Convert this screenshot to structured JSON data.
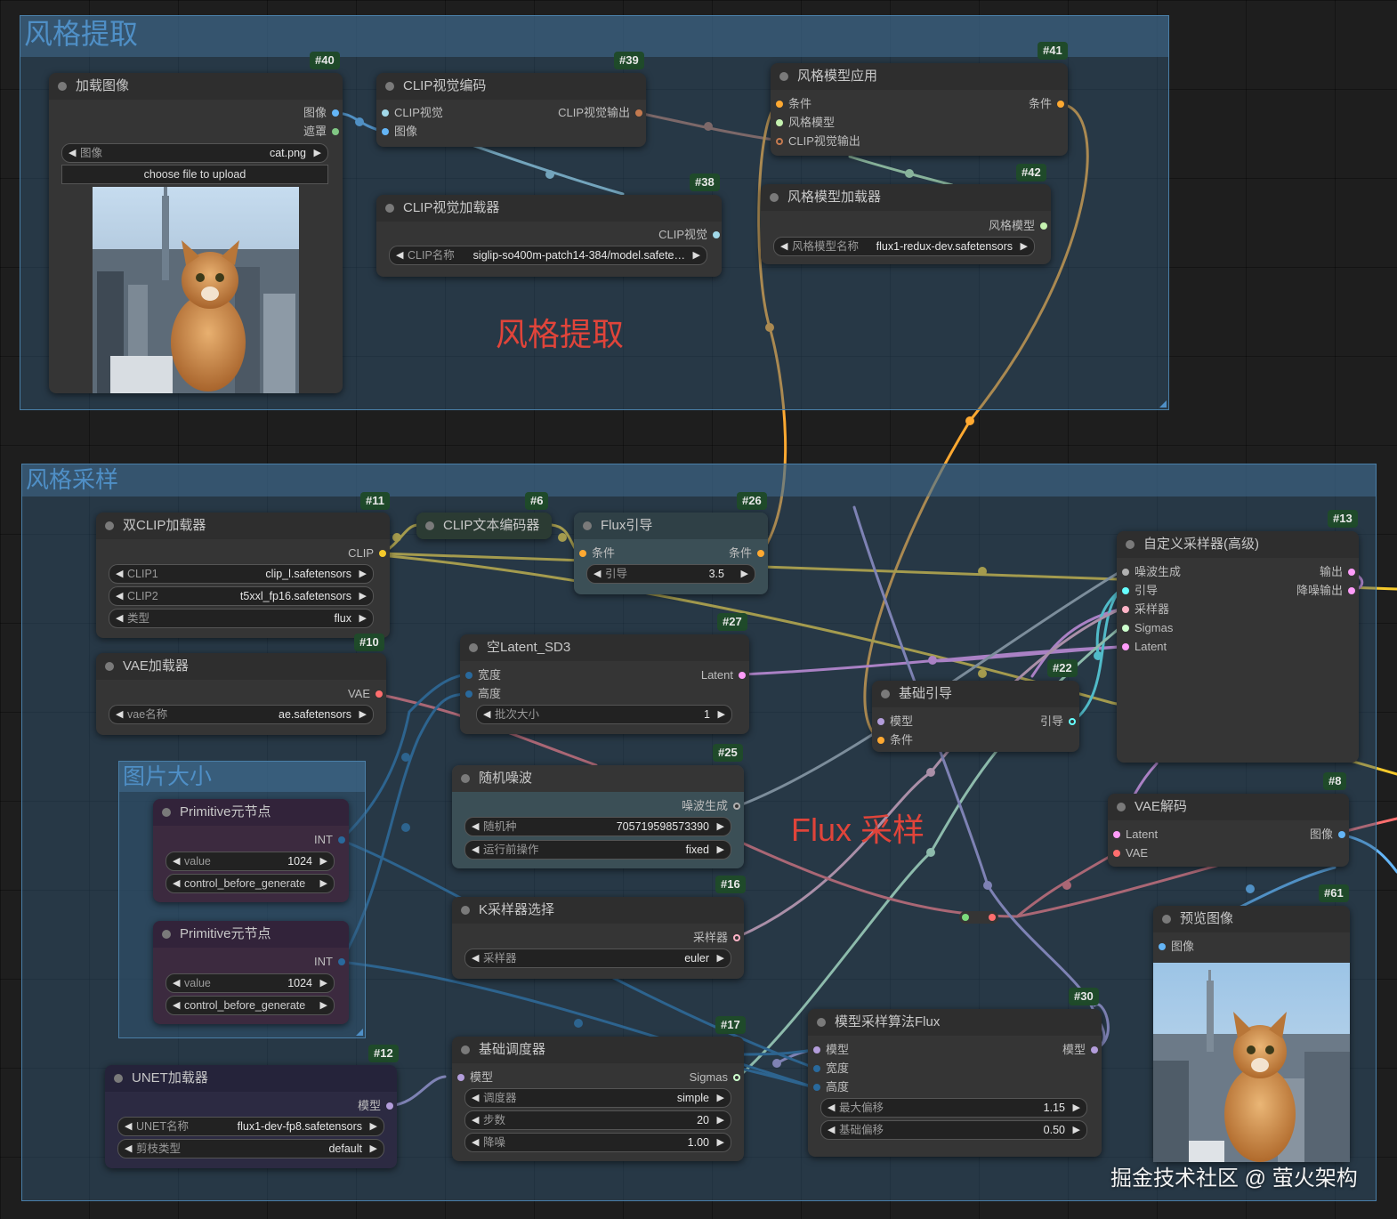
{
  "groups": {
    "extract": {
      "title": "风格提取"
    },
    "sampling": {
      "title": "风格采样"
    },
    "image_size": {
      "title": "图片大小"
    }
  },
  "notes": {
    "extract": "风格提取",
    "flux": "Flux 采样"
  },
  "watermark": "掘金技术社区 @ 萤火架构",
  "nodes": {
    "load_image": {
      "id": "#40",
      "title": "加载图像",
      "out_image": "图像",
      "out_mask": "遮罩",
      "widget_label": "图像",
      "widget_value": "cat.png",
      "upload_label": "choose file to upload"
    },
    "clip_vision_encode": {
      "id": "#39",
      "title": "CLIP视觉编码",
      "in_clip_vision": "CLIP视觉",
      "in_image": "图像",
      "out": "CLIP视觉输出"
    },
    "clip_vision_loader": {
      "id": "#38",
      "title": "CLIP视觉加载器",
      "out": "CLIP视觉",
      "widget_label": "CLIP名称",
      "widget_value": "siglip-so400m-patch14-384/model.safete…"
    },
    "style_apply": {
      "id": "#41",
      "title": "风格模型应用",
      "in_cond": "条件",
      "in_style": "风格模型",
      "in_clip_out": "CLIP视觉输出",
      "out": "条件"
    },
    "style_loader": {
      "id": "#42",
      "title": "风格模型加载器",
      "out": "风格模型",
      "widget_label": "风格模型名称",
      "widget_value": "flux1-redux-dev.safetensors"
    },
    "dual_clip": {
      "id": "#11",
      "title": "双CLIP加载器",
      "out": "CLIP",
      "w1_label": "CLIP1",
      "w1_value": "clip_l.safetensors",
      "w2_label": "CLIP2",
      "w2_value": "t5xxl_fp16.safetensors",
      "w3_label": "类型",
      "w3_value": "flux"
    },
    "clip_text": {
      "id": "#6",
      "title": "CLIP文本编码器"
    },
    "flux_guidance": {
      "id": "#26",
      "title": "Flux引导",
      "in": "条件",
      "out": "条件",
      "widget_label": "引导",
      "widget_value": "3.5"
    },
    "vae_loader": {
      "id": "#10",
      "title": "VAE加载器",
      "out": "VAE",
      "widget_label": "vae名称",
      "widget_value": "ae.safetensors"
    },
    "empty_latent": {
      "id": "#27",
      "title": "空Latent_SD3",
      "in_w": "宽度",
      "in_h": "高度",
      "out": "Latent",
      "widget_label": "批次大小",
      "widget_value": "1"
    },
    "random_noise": {
      "id": "#25",
      "title": "随机噪波",
      "out": "噪波生成",
      "w1_label": "随机种",
      "w1_value": "705719598573390",
      "w2_label": "运行前操作",
      "w2_value": "fixed"
    },
    "ksampler_select": {
      "id": "#16",
      "title": "K采样器选择",
      "out": "采样器",
      "widget_label": "采样器",
      "widget_value": "euler"
    },
    "basic_scheduler": {
      "id": "#17",
      "title": "基础调度器",
      "in": "模型",
      "out": "Sigmas",
      "w1_label": "调度器",
      "w1_value": "simple",
      "w2_label": "步数",
      "w2_value": "20",
      "w3_label": "降噪",
      "w3_value": "1.00"
    },
    "unet_loader": {
      "id": "#12",
      "title": "UNET加载器",
      "out": "模型",
      "w1_label": "UNET名称",
      "w1_value": "flux1-dev-fp8.safetensors",
      "w2_label": "剪枝类型",
      "w2_value": "default"
    },
    "primitive1": {
      "title": "Primitive元节点",
      "out": "INT",
      "w1_label": "value",
      "w1_value": "1024",
      "w2_label": "control_before_generate"
    },
    "primitive2": {
      "title": "Primitive元节点",
      "out": "INT",
      "w1_label": "value",
      "w1_value": "1024",
      "w2_label": "control_before_generate"
    },
    "basic_guider": {
      "id": "#22",
      "title": "基础引导",
      "in_model": "模型",
      "in_cond": "条件",
      "out": "引导"
    },
    "custom_sampler": {
      "id": "#13",
      "title": "自定义采样器(高级)",
      "in1": "噪波生成",
      "in2": "引导",
      "in3": "采样器",
      "in4": "Sigmas",
      "in5": "Latent",
      "out1": "输出",
      "out2": "降噪输出"
    },
    "vae_decode": {
      "id": "#8",
      "title": "VAE解码",
      "in1": "Latent",
      "in2": "VAE",
      "out": "图像"
    },
    "model_sampling": {
      "id": "#30",
      "title": "模型采样算法Flux",
      "in1": "模型",
      "in2": "宽度",
      "in3": "高度",
      "out": "模型",
      "w1_label": "最大偏移",
      "w1_value": "1.15",
      "w2_label": "基础偏移",
      "w2_value": "0.50"
    },
    "preview": {
      "id": "#61",
      "title": "预览图像",
      "in": "图像"
    }
  },
  "colors": {
    "clip": "#f5c92b",
    "cond": "#ffa931",
    "latent": "#ff9cf9",
    "vae": "#ff6e6e",
    "image": "#64b5f6",
    "int": "#29699c",
    "model": "#b39ddb",
    "clip_vision": "#a1d8e8",
    "style_model": "#c5f2b0",
    "noise": "#b0b0b0",
    "guider": "#66ffff",
    "sampler": "#ffb3c6",
    "sigmas": "#cdffcd",
    "group": "#4f8fc6"
  }
}
